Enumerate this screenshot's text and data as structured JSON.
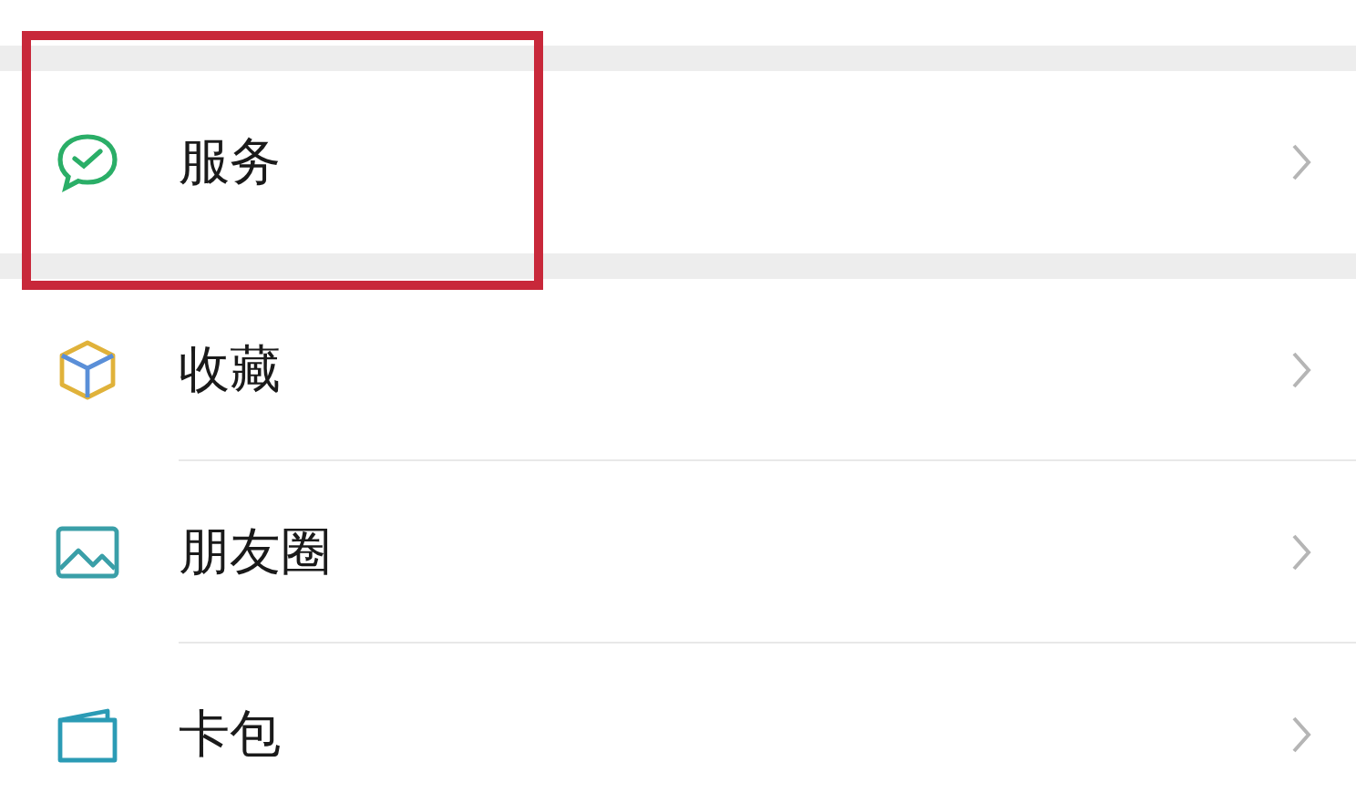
{
  "menu_groups": [
    {
      "items": [
        {
          "label": "服务",
          "highlighted": true
        }
      ]
    },
    {
      "items": [
        {
          "label": "收藏",
          "highlighted": false
        },
        {
          "label": "朋友圈",
          "highlighted": false
        },
        {
          "label": "卡包",
          "highlighted": false
        }
      ]
    }
  ]
}
